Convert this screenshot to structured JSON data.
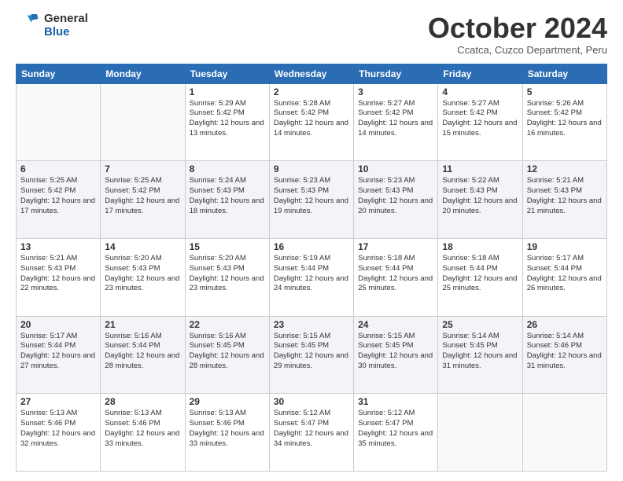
{
  "header": {
    "logo_general": "General",
    "logo_blue": "Blue",
    "month_title": "October 2024",
    "subtitle": "Ccatca, Cuzco Department, Peru"
  },
  "weekdays": [
    "Sunday",
    "Monday",
    "Tuesday",
    "Wednesday",
    "Thursday",
    "Friday",
    "Saturday"
  ],
  "weeks": [
    [
      {
        "day": "",
        "info": ""
      },
      {
        "day": "",
        "info": ""
      },
      {
        "day": "1",
        "info": "Sunrise: 5:29 AM\nSunset: 5:42 PM\nDaylight: 12 hours and 13 minutes."
      },
      {
        "day": "2",
        "info": "Sunrise: 5:28 AM\nSunset: 5:42 PM\nDaylight: 12 hours and 14 minutes."
      },
      {
        "day": "3",
        "info": "Sunrise: 5:27 AM\nSunset: 5:42 PM\nDaylight: 12 hours and 14 minutes."
      },
      {
        "day": "4",
        "info": "Sunrise: 5:27 AM\nSunset: 5:42 PM\nDaylight: 12 hours and 15 minutes."
      },
      {
        "day": "5",
        "info": "Sunrise: 5:26 AM\nSunset: 5:42 PM\nDaylight: 12 hours and 16 minutes."
      }
    ],
    [
      {
        "day": "6",
        "info": "Sunrise: 5:25 AM\nSunset: 5:42 PM\nDaylight: 12 hours and 17 minutes."
      },
      {
        "day": "7",
        "info": "Sunrise: 5:25 AM\nSunset: 5:42 PM\nDaylight: 12 hours and 17 minutes."
      },
      {
        "day": "8",
        "info": "Sunrise: 5:24 AM\nSunset: 5:43 PM\nDaylight: 12 hours and 18 minutes."
      },
      {
        "day": "9",
        "info": "Sunrise: 5:23 AM\nSunset: 5:43 PM\nDaylight: 12 hours and 19 minutes."
      },
      {
        "day": "10",
        "info": "Sunrise: 5:23 AM\nSunset: 5:43 PM\nDaylight: 12 hours and 20 minutes."
      },
      {
        "day": "11",
        "info": "Sunrise: 5:22 AM\nSunset: 5:43 PM\nDaylight: 12 hours and 20 minutes."
      },
      {
        "day": "12",
        "info": "Sunrise: 5:21 AM\nSunset: 5:43 PM\nDaylight: 12 hours and 21 minutes."
      }
    ],
    [
      {
        "day": "13",
        "info": "Sunrise: 5:21 AM\nSunset: 5:43 PM\nDaylight: 12 hours and 22 minutes."
      },
      {
        "day": "14",
        "info": "Sunrise: 5:20 AM\nSunset: 5:43 PM\nDaylight: 12 hours and 23 minutes."
      },
      {
        "day": "15",
        "info": "Sunrise: 5:20 AM\nSunset: 5:43 PM\nDaylight: 12 hours and 23 minutes."
      },
      {
        "day": "16",
        "info": "Sunrise: 5:19 AM\nSunset: 5:44 PM\nDaylight: 12 hours and 24 minutes."
      },
      {
        "day": "17",
        "info": "Sunrise: 5:18 AM\nSunset: 5:44 PM\nDaylight: 12 hours and 25 minutes."
      },
      {
        "day": "18",
        "info": "Sunrise: 5:18 AM\nSunset: 5:44 PM\nDaylight: 12 hours and 25 minutes."
      },
      {
        "day": "19",
        "info": "Sunrise: 5:17 AM\nSunset: 5:44 PM\nDaylight: 12 hours and 26 minutes."
      }
    ],
    [
      {
        "day": "20",
        "info": "Sunrise: 5:17 AM\nSunset: 5:44 PM\nDaylight: 12 hours and 27 minutes."
      },
      {
        "day": "21",
        "info": "Sunrise: 5:16 AM\nSunset: 5:44 PM\nDaylight: 12 hours and 28 minutes."
      },
      {
        "day": "22",
        "info": "Sunrise: 5:16 AM\nSunset: 5:45 PM\nDaylight: 12 hours and 28 minutes."
      },
      {
        "day": "23",
        "info": "Sunrise: 5:15 AM\nSunset: 5:45 PM\nDaylight: 12 hours and 29 minutes."
      },
      {
        "day": "24",
        "info": "Sunrise: 5:15 AM\nSunset: 5:45 PM\nDaylight: 12 hours and 30 minutes."
      },
      {
        "day": "25",
        "info": "Sunrise: 5:14 AM\nSunset: 5:45 PM\nDaylight: 12 hours and 31 minutes."
      },
      {
        "day": "26",
        "info": "Sunrise: 5:14 AM\nSunset: 5:46 PM\nDaylight: 12 hours and 31 minutes."
      }
    ],
    [
      {
        "day": "27",
        "info": "Sunrise: 5:13 AM\nSunset: 5:46 PM\nDaylight: 12 hours and 32 minutes."
      },
      {
        "day": "28",
        "info": "Sunrise: 5:13 AM\nSunset: 5:46 PM\nDaylight: 12 hours and 33 minutes."
      },
      {
        "day": "29",
        "info": "Sunrise: 5:13 AM\nSunset: 5:46 PM\nDaylight: 12 hours and 33 minutes."
      },
      {
        "day": "30",
        "info": "Sunrise: 5:12 AM\nSunset: 5:47 PM\nDaylight: 12 hours and 34 minutes."
      },
      {
        "day": "31",
        "info": "Sunrise: 5:12 AM\nSunset: 5:47 PM\nDaylight: 12 hours and 35 minutes."
      },
      {
        "day": "",
        "info": ""
      },
      {
        "day": "",
        "info": ""
      }
    ]
  ]
}
